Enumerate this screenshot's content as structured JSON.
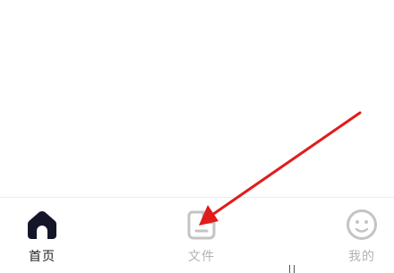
{
  "tabbar": {
    "tabs": [
      {
        "label": "首页",
        "icon": "home-icon",
        "active": true,
        "color": "#15152a"
      },
      {
        "label": "文件",
        "icon": "file-icon",
        "active": false,
        "color": "#c4c4c4"
      },
      {
        "label": "我的",
        "icon": "profile-face-icon",
        "active": false,
        "color": "#c4c4c4"
      }
    ]
  },
  "annotation": {
    "color": "#e21b1b",
    "icon": "red-arrow-pointer"
  }
}
